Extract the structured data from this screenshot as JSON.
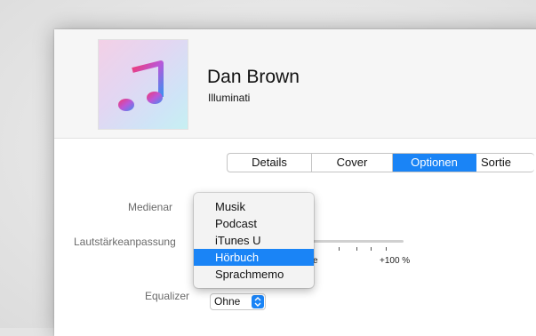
{
  "header": {
    "artist": "Dan Brown",
    "album": "Illuminati",
    "artwork_icon": "music-note-icon"
  },
  "tabs": [
    {
      "label": "Details",
      "active": false
    },
    {
      "label": "Cover",
      "active": false
    },
    {
      "label": "Optionen",
      "active": true
    },
    {
      "label": "Sortie",
      "active": false
    }
  ],
  "form": {
    "media_type_label": "Medienar",
    "volume_label": "Lautstärkeanpassung",
    "volume_scale_partial": "e",
    "volume_scale_max": "+100 %",
    "equalizer_label": "Equalizer",
    "equalizer_value": "Ohne"
  },
  "media_menu": {
    "items": [
      "Musik",
      "Podcast",
      "iTunes U",
      "Hörbuch",
      "Sprachmemo"
    ],
    "selected": "Hörbuch"
  },
  "colors": {
    "accent": "#1a84f6"
  }
}
